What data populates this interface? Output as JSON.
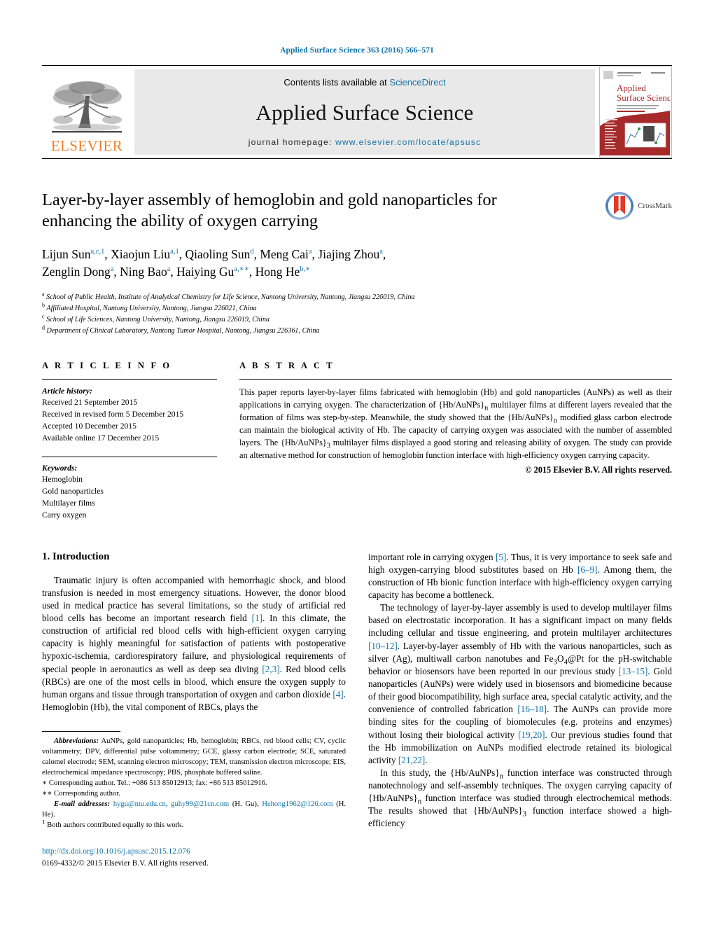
{
  "running_head": "Applied Surface Science 363 (2016) 566–571",
  "masthead": {
    "publisher_name": "ELSEVIER",
    "contents_prefix": "Contents lists available at ",
    "contents_link": "ScienceDirect",
    "journal_name": "Applied Surface Science",
    "homepage_prefix": "journal homepage: ",
    "homepage_url": "www.elsevier.com/locate/apsusc",
    "cover_title_line1": "Applied",
    "cover_title_line2": "Surface Science"
  },
  "article": {
    "title": "Layer-by-layer assembly of hemoglobin and gold nanoparticles for enhancing the ability of oxygen carrying",
    "crossmark_label": "CrossMark",
    "authors_line1_parts": [
      {
        "t": "Lijun Sun",
        "sup": "a,c,1"
      },
      {
        "t": ", Xiaojun Liu",
        "sup": "a,1"
      },
      {
        "t": ", Qiaoling Sun",
        "sup": "d"
      },
      {
        "t": ", Meng Cai",
        "sup": "a"
      },
      {
        "t": ", Jiajing Zhou",
        "sup": "a"
      },
      {
        "t": ",",
        "sup": ""
      }
    ],
    "authors_line2_parts": [
      {
        "t": "Zenglin Dong",
        "sup": "a"
      },
      {
        "t": ", Ning Bao",
        "sup": "a"
      },
      {
        "t": ", Haiying Gu",
        "sup": "a,∗∗"
      },
      {
        "t": ", Hong He",
        "sup": "b,∗"
      }
    ],
    "affiliations": [
      {
        "mark": "a",
        "text": "School of Public Health, Institute of Analytical Chemistry for Life Science, Nantong University, Nantong, Jiangsu 226019, China"
      },
      {
        "mark": "b",
        "text": "Affiliated Hospital, Nantong University, Nantong, Jiangsu 226021, China"
      },
      {
        "mark": "c",
        "text": "School of Life Sciences, Nantong University, Nantong, Jiangsu 226019, China"
      },
      {
        "mark": "d",
        "text": "Department of Clinical Laboratory, Nantong Tumor Hospital, Nantong, Jiangsu 226361, China"
      }
    ]
  },
  "article_info": {
    "heading": "A R T I C L E    I N F O",
    "history_label": "Article history:",
    "history": [
      "Received 21 September 2015",
      "Received in revised form 5 December 2015",
      "Accepted 10 December 2015",
      "Available online 17 December 2015"
    ],
    "keywords_label": "Keywords:",
    "keywords": [
      "Hemoglobin",
      "Gold nanoparticles",
      "Multilayer films",
      "Carry oxygen"
    ]
  },
  "abstract": {
    "heading": "A B S T R A C T",
    "text_part1": "This paper reports layer-by-layer films fabricated with hemoglobin (Hb) and gold nanoparticles (AuNPs) as well as their applications in carrying oxygen. The characterization of {Hb/AuNPs}",
    "sub1": "n",
    "text_part2": " multilayer films at different layers revealed that the formation of films was step-by-step. Meanwhile, the study showed that the {Hb/AuNPs}",
    "sub2": "n",
    "text_part3": " modified glass carbon electrode can maintain the biological activity of Hb. The capacity of carrying oxygen was associated with the number of assembled layers. The {Hb/AuNPs}",
    "sub3": "3",
    "text_part4": " multilayer films displayed a good storing and releasing ability of oxygen. The study can provide an alternative method for construction of hemoglobin function interface with high-efficiency oxygen carrying capacity.",
    "copyright": "© 2015 Elsevier B.V. All rights reserved."
  },
  "intro": {
    "heading": "1.  Introduction",
    "left_p1_a": "Traumatic injury is often accompanied with hemorrhagic shock, and blood transfusion is needed in most emergency situations. However, the donor blood used in medical practice has several limitations, so the study of artificial red blood cells has become an important research field ",
    "left_cite1": "[1]",
    "left_p1_b": ". In this climate, the construction of artificial red blood cells with high-efficient oxygen carrying capacity is highly meaningful for satisfaction of patients with postoperative hypoxic-ischemia, cardiorespiratory failure, and physiological requirements of special people in aeronautics as well as deep sea diving ",
    "left_cite2": "[2,3]",
    "left_p1_c": ". Red blood cells (RBCs) are one of the most cells in blood, which ensure the oxygen supply to human organs and tissue through transportation of oxygen and carbon dioxide ",
    "left_cite3": "[4]",
    "left_p1_d": ". Hemoglobin (Hb), the vital component of RBCs, plays the",
    "right_p1_a": "important role in carrying oxygen ",
    "right_cite1": "[5]",
    "right_p1_b": ". Thus, it is very importance to seek safe and high oxygen-carrying blood substitutes based on Hb ",
    "right_cite2": "[6–9]",
    "right_p1_c": ". Among them, the construction of Hb bionic function interface with high-efficiency oxygen carrying capacity has become a bottleneck.",
    "right_p2_a": "The technology of layer-by-layer assembly is used to develop multilayer films based on electrostatic incorporation. It has a significant impact on many fields including cellular and tissue engineering, and protein multilayer architectures ",
    "right_cite3": "[10–12]",
    "right_p2_b": ". Layer-by-layer assembly of Hb with the various nanoparticles, such as silver (Ag), multiwall carbon nanotubes and Fe",
    "right_sub_fe": "3",
    "right_p2_c": "O",
    "right_sub_o": "4",
    "right_p2_d": "@Pt for the pH-switchable behavior or biosensors have been reported in our previous study ",
    "right_cite4": "[13–15]",
    "right_p2_e": ". Gold nanoparticles (AuNPs) were widely used in biosensors and biomedicine because of their good biocompatibility, high surface area, special catalytic activity, and the convenience of controlled fabrication ",
    "right_cite5": "[16–18]",
    "right_p2_f": ". The AuNPs can provide more binding sites for the coupling of biomolecules (e.g. proteins and enzymes) without losing their biological activity ",
    "right_cite6": "[19,20]",
    "right_p2_g": ". Our previous studies found that the Hb immobilization on AuNPs modified electrode retained its biological activity ",
    "right_cite7": "[21,22]",
    "right_p2_h": ".",
    "right_p3_a": "In this study, the {Hb/AuNPs}",
    "right_sub_n1": "n",
    "right_p3_b": " function interface was constructed through nanotechnology and self-assembly techniques. The oxygen carrying capacity of {Hb/AuNPs}",
    "right_sub_n2": "n",
    "right_p3_c": " function interface was studied through electrochemical methods. The results showed that {Hb/AuNPs}",
    "right_sub_3": "3",
    "right_p3_d": " function interface showed a high-efficiency"
  },
  "footnotes": {
    "abbrev_label": "Abbreviations:",
    "abbrev_text": "  AuNPs, gold nanoparticles; Hb, hemoglobin; RBCs, red blood cells; CV, cyclic voltammetry; DPV, differential pulse voltammetry; GCE, glassy carbon electrode; SCE, saturated calomel electrode; SEM, scanning electron microscopy; TEM, transmission electron microscope; EIS, electrochemical impedance spectroscopy; PBS, phosphate buffered saline.",
    "corr1": "∗ Corresponding author. Tel.: +086 513 85012913; fax: +86 513 85012916.",
    "corr2": "∗∗ Corresponding author.",
    "email_label": "E-mail addresses:",
    "email1": "hygu@ntu.edu.cn",
    "email_sep": ", ",
    "email2": "guhy99@21cn.com",
    "email_owner1": " (H. Gu),",
    "email3": "Hehong1962@126.com",
    "email_owner2": " (H. He).",
    "equal_note_mark": "1",
    "equal_note": " Both authors contributed equally to this work.",
    "doi": "http://dx.doi.org/10.1016/j.apsusc.2015.12.076",
    "issn_line": "0169-4332/© 2015 Elsevier B.V. All rights reserved."
  },
  "colors": {
    "link_blue": "#1172a8",
    "elsevier_orange": "#f07e26",
    "band_gray": "#e9e9e9",
    "cover_red": "#a62a2a",
    "crossmark_blue": "#4a7fc1"
  }
}
